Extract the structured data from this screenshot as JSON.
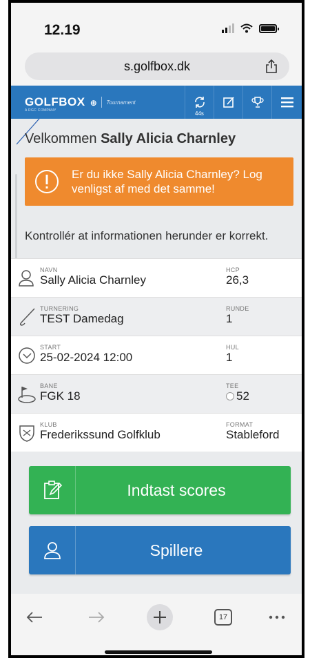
{
  "status": {
    "time": "12.19"
  },
  "browser": {
    "url": "s.golfbox.dk",
    "tab_count": "17"
  },
  "header": {
    "logo": "GOLFBOX",
    "logo_sub": "A RGC COMPANY",
    "section": "Tournament",
    "sync_count": "44s"
  },
  "welcome": {
    "prefix": "Velkommen ",
    "name": "Sally Alicia Charnley"
  },
  "alert": {
    "text": "Er du ikke Sally Alicia Charnley? Log venligst af med det samme!"
  },
  "instruction": "Kontrollér at informationen herunder er korrekt.",
  "rows": [
    {
      "icon": "person-icon",
      "left_label": "NAVN",
      "left_value": "Sally Alicia Charnley",
      "right_label": "HCP",
      "right_value": "26,3"
    },
    {
      "icon": "golf-club-icon",
      "left_label": "TURNERING",
      "left_value": "TEST Damedag",
      "right_label": "RUNDE",
      "right_value": "1"
    },
    {
      "icon": "clock-icon",
      "left_label": "START",
      "left_value": "25-02-2024 12:00",
      "right_label": "HUL",
      "right_value": "1"
    },
    {
      "icon": "flag-green-icon",
      "left_label": "BANE",
      "left_value": "FGK 18",
      "right_label": "TEE",
      "right_value": "52"
    },
    {
      "icon": "club-crest-icon",
      "left_label": "KLUB",
      "left_value": "Frederikssund Golfklub",
      "right_label": "FORMAT",
      "right_value": "Stableford"
    }
  ],
  "buttons": {
    "enter_scores": "Indtast scores",
    "players": "Spillere"
  },
  "colors": {
    "header_blue": "#2a77bd",
    "alert_orange": "#ef8a2e",
    "green": "#33b254"
  }
}
